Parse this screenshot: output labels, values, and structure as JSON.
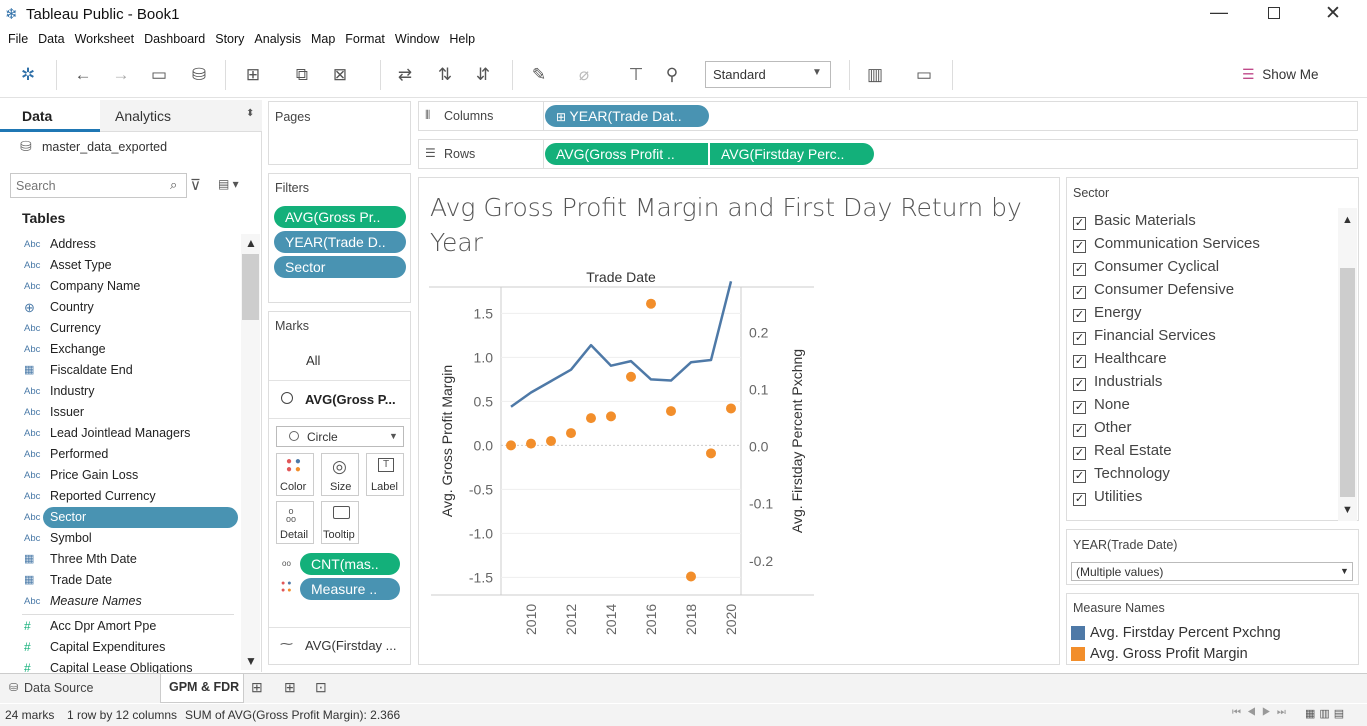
{
  "app": {
    "title": "Tableau Public - Book1"
  },
  "menu": [
    "File",
    "Data",
    "Worksheet",
    "Dashboard",
    "Story",
    "Analysis",
    "Map",
    "Format",
    "Window",
    "Help"
  ],
  "toolbar": {
    "fit": "Standard",
    "show_me": "Show Me"
  },
  "data_pane": {
    "tabs": [
      "Data",
      "Analytics"
    ],
    "source": "master_data_exported",
    "search_placeholder": "Search",
    "tables_label": "Tables",
    "fields": [
      {
        "type": "Abc",
        "name": "Address"
      },
      {
        "type": "Abc",
        "name": "Asset Type"
      },
      {
        "type": "Abc",
        "name": "Company Name"
      },
      {
        "type": "globe",
        "name": "Country"
      },
      {
        "type": "Abc",
        "name": "Currency"
      },
      {
        "type": "Abc",
        "name": "Exchange"
      },
      {
        "type": "date",
        "name": "Fiscaldate End"
      },
      {
        "type": "Abc",
        "name": "Industry"
      },
      {
        "type": "Abc",
        "name": "Issuer"
      },
      {
        "type": "Abc",
        "name": "Lead Jointlead Managers"
      },
      {
        "type": "Abc",
        "name": "Performed"
      },
      {
        "type": "Abc",
        "name": "Price Gain Loss"
      },
      {
        "type": "Abc",
        "name": "Reported Currency"
      },
      {
        "type": "Abc",
        "name": "Sector",
        "selected": true
      },
      {
        "type": "Abc",
        "name": "Symbol"
      },
      {
        "type": "date",
        "name": "Three Mth Date"
      },
      {
        "type": "date",
        "name": "Trade Date"
      },
      {
        "type": "Abc",
        "name": "Measure Names",
        "italic": true
      }
    ],
    "measures": [
      {
        "type": "#",
        "name": "Acc Dpr Amort Ppe"
      },
      {
        "type": "#",
        "name": "Capital Expenditures"
      },
      {
        "type": "#",
        "name": "Capital Lease Obligations"
      }
    ]
  },
  "pages": {
    "label": "Pages"
  },
  "filters": {
    "label": "Filters",
    "pills": [
      "AVG(Gross Pr..",
      "YEAR(Trade D..",
      "Sector"
    ]
  },
  "marks": {
    "label": "Marks",
    "all": "All",
    "card_name": "AVG(Gross P...",
    "mark_type": "Circle",
    "buttons": [
      "Color",
      "Size",
      "Label",
      "Detail",
      "Tooltip"
    ],
    "pills": [
      "CNT(mas..",
      "Measure .."
    ],
    "second": "AVG(Firstday ..."
  },
  "shelves": {
    "columns_label": "Columns",
    "rows_label": "Rows",
    "columns": [
      "YEAR(Trade Dat.."
    ],
    "rows": [
      "AVG(Gross Profit ..",
      "AVG(Firstday Perc.."
    ]
  },
  "sector_filter": {
    "label": "Sector",
    "items": [
      "Basic Materials",
      "Communication Services",
      "Consumer Cyclical",
      "Consumer Defensive",
      "Energy",
      "Financial Services",
      "Healthcare",
      "Industrials",
      "None",
      "Other",
      "Real Estate",
      "Technology",
      "Utilities"
    ]
  },
  "year_filter": {
    "label": "YEAR(Trade Date)",
    "value": "(Multiple values)"
  },
  "legend": {
    "label": "Measure Names",
    "items": [
      {
        "name": "Avg. Firstday Percent Pxchng",
        "color": "#4e79a7"
      },
      {
        "name": "Avg. Gross Profit Margin",
        "color": "#f28e2b"
      }
    ]
  },
  "sheet_tabs": {
    "data_source": "Data Source",
    "active": "GPM & FDR"
  },
  "status": {
    "marks": "24 marks",
    "dims": "1 row by 12 columns",
    "sum": "SUM of AVG(Gross Profit Margin): 2.366"
  },
  "chart_data": {
    "type": "line",
    "title": "Avg Gross Profit Margin and First Day Return by Year",
    "top_header": "Trade Date",
    "x": [
      2009,
      2010,
      2011,
      2012,
      2013,
      2014,
      2015,
      2016,
      2017,
      2018,
      2019,
      2020
    ],
    "xticks": [
      "2010",
      "2012",
      "2014",
      "2016",
      "2018",
      "2020"
    ],
    "y_left": {
      "label": "Avg. Gross Profit Margin",
      "ticks": [
        "1.5",
        "1.0",
        "0.5",
        "0.0",
        "-0.5",
        "-1.0",
        "-1.5"
      ],
      "lim": [
        -1.7,
        1.8
      ]
    },
    "y_right": {
      "label": "Avg. Firstday Percent Pxchng",
      "ticks": [
        "0.2",
        "0.1",
        "0.0",
        "-0.1",
        "-0.2"
      ],
      "lim": [
        -0.26,
        0.28
      ]
    },
    "series": [
      {
        "name": "Avg. Gross Profit Margin",
        "color": "#f28e2b",
        "mark": "circle",
        "axis": "left",
        "values": [
          0.0,
          0.02,
          0.05,
          0.14,
          0.31,
          0.33,
          0.78,
          1.61,
          0.39,
          -1.49,
          -0.09,
          0.42
        ]
      },
      {
        "name": "Avg. Firstday Percent Pxchng",
        "color": "#4e79a7",
        "mark": "line",
        "axis": "right",
        "values": [
          0.07,
          0.095,
          0.115,
          0.135,
          0.178,
          0.142,
          0.15,
          0.118,
          0.116,
          0.148,
          0.152,
          0.29
        ]
      }
    ]
  }
}
